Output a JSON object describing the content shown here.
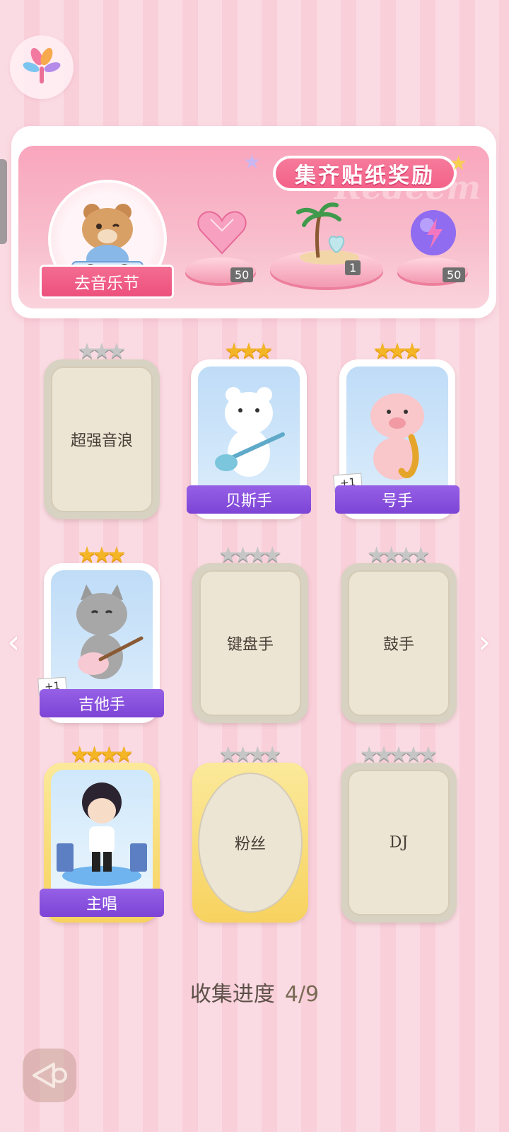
{
  "banner": {
    "title": "集齐贴纸奖励",
    "watermark": "Redeem",
    "go_button": "去音乐节",
    "rewards": [
      {
        "name": "pink-heart-gem-icon",
        "count": "50"
      },
      {
        "name": "palm-island-icon",
        "count": "1"
      },
      {
        "name": "lightning-orb-icon",
        "count": "50"
      }
    ]
  },
  "cards": [
    {
      "label": "超强音浪",
      "unlocked": false,
      "stars": "☆☆☆"
    },
    {
      "label": "贝斯手",
      "unlocked": true,
      "stars": "★★★"
    },
    {
      "label": "号手",
      "unlocked": true,
      "stars": "★★★",
      "badge": "+1"
    },
    {
      "label": "吉他手",
      "unlocked": true,
      "stars": "★★★",
      "badge": "+1"
    },
    {
      "label": "键盘手",
      "unlocked": false,
      "stars": "☆☆☆☆"
    },
    {
      "label": "鼓手",
      "unlocked": false,
      "stars": "☆☆☆☆"
    },
    {
      "label": "主唱",
      "unlocked": true,
      "stars": "★★★★"
    },
    {
      "label": "粉丝",
      "unlocked": false,
      "stars": "☆☆☆☆"
    },
    {
      "label": "DJ",
      "unlocked": false,
      "stars": "☆☆☆☆☆"
    }
  ],
  "progress": {
    "label": "收集进度",
    "value": "4/9"
  },
  "colors": {
    "accent_pink": "#f35f87",
    "banner_purple": "#7d44d6",
    "star_gold": "#f4b526"
  }
}
